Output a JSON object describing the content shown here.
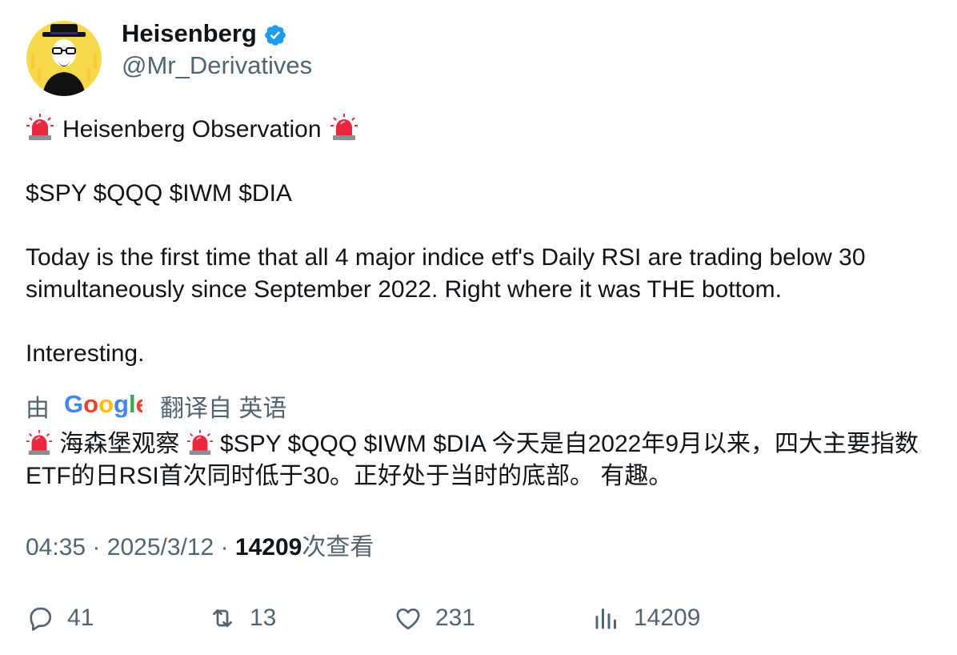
{
  "author": {
    "display_name": "Heisenberg",
    "handle": "@Mr_Derivatives",
    "verified": true,
    "verified_color": "#1d9bf0",
    "avatar_bg": "#f7d84a"
  },
  "tweet": {
    "title": "Heisenberg Observation",
    "cashtags": [
      "$SPY",
      "$QQQ",
      "$IWM",
      "$DIA"
    ],
    "paragraph_1": "Today is the first time that all 4 major indice etf's Daily RSI are trading below 30 simultaneously since September 2022.  Right where it was THE bottom.",
    "paragraph_2": "Interesting."
  },
  "translation": {
    "prefix": "由",
    "provider_logo": "Google",
    "translated_from": "翻译自 英语",
    "title": "海森堡观察",
    "text": "$SPY $QQQ $IWM $DIA 今天是自2022年9月以来，四大主要指数ETF的日RSI首次同时低于30。正好处于当时的底部。 有趣。"
  },
  "meta": {
    "time": "04:35",
    "separator": "·",
    "date": "2025/3/12",
    "views_count": "14209",
    "views_label": "次查看"
  },
  "actions": {
    "replies": "41",
    "retweets": "13",
    "likes": "231",
    "views": "14209"
  },
  "icons": {
    "siren": "police-siren-emoji",
    "reply": "reply-icon",
    "retweet": "retweet-icon",
    "like": "heart-icon",
    "views": "analytics-icon",
    "verified": "verified-badge-icon"
  },
  "colors": {
    "text": "#0f1419",
    "secondary": "#536471",
    "verified": "#1d9bf0"
  }
}
